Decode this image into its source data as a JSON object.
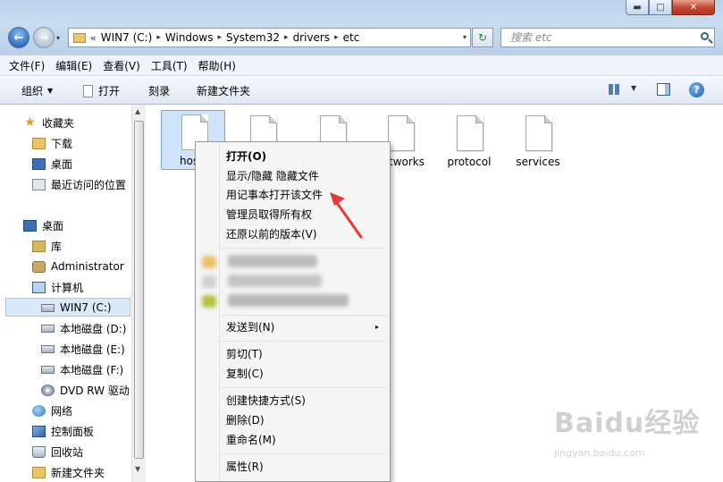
{
  "window": {
    "controls": {
      "minimize": "▬",
      "maximize": "□",
      "close": "✕"
    }
  },
  "nav": {
    "back": "←",
    "forward": "→",
    "dropdown": "▾"
  },
  "address": {
    "overflow": "«",
    "crumbs": [
      "WIN7 (C:)",
      "Windows",
      "System32",
      "drivers",
      "etc"
    ],
    "separator": "▸",
    "dropdown": "▾"
  },
  "refresh_glyph": "↻",
  "search": {
    "placeholder": "搜索 etc"
  },
  "menubar": [
    "文件(F)",
    "编辑(E)",
    "查看(V)",
    "工具(T)",
    "帮助(H)"
  ],
  "toolbar": {
    "organize": "组织",
    "open": "打开",
    "burn": "刻录",
    "new_folder": "新建文件夹",
    "help": "?"
  },
  "navpane": {
    "favorites": "收藏夹",
    "downloads": "下载",
    "desktop_fav": "桌面",
    "recent": "最近访问的位置",
    "desktop": "桌面",
    "libraries": "库",
    "user": "Administrator",
    "computer": "计算机",
    "drive_c": "WIN7 (C:)",
    "drive_d": "本地磁盘 (D:)",
    "drive_e": "本地磁盘 (E:)",
    "drive_f": "本地磁盘 (F:)",
    "dvd": "DVD RW 驱动",
    "network": "网络",
    "control_panel": "控制面板",
    "recycle_bin": "回收站",
    "new_folder": "新建文件夹"
  },
  "files": {
    "hosts_partial": "hos",
    "networks_partial": "tworks",
    "protocol": "protocol",
    "services": "services"
  },
  "context_menu": {
    "open": "打开(O)",
    "toggle_hidden": "显示/隐藏 隐藏文件",
    "open_notepad": "用记事本打开该文件",
    "take_ownership": "管理员取得所有权",
    "restore": "还原以前的版本(V)",
    "send_to": "发送到(N)",
    "cut": "剪切(T)",
    "copy": "复制(C)",
    "create_shortcut": "创建快捷方式(S)",
    "delete": "删除(D)",
    "rename": "重命名(M)",
    "properties": "属性(R)",
    "submenu_arrow": "▸"
  },
  "watermark": {
    "logo": "Baidu经验",
    "url": "jingyan.baidu.com"
  },
  "colors": {
    "annotation_arrow": "#e53935",
    "selection": "#cfe3fb"
  }
}
